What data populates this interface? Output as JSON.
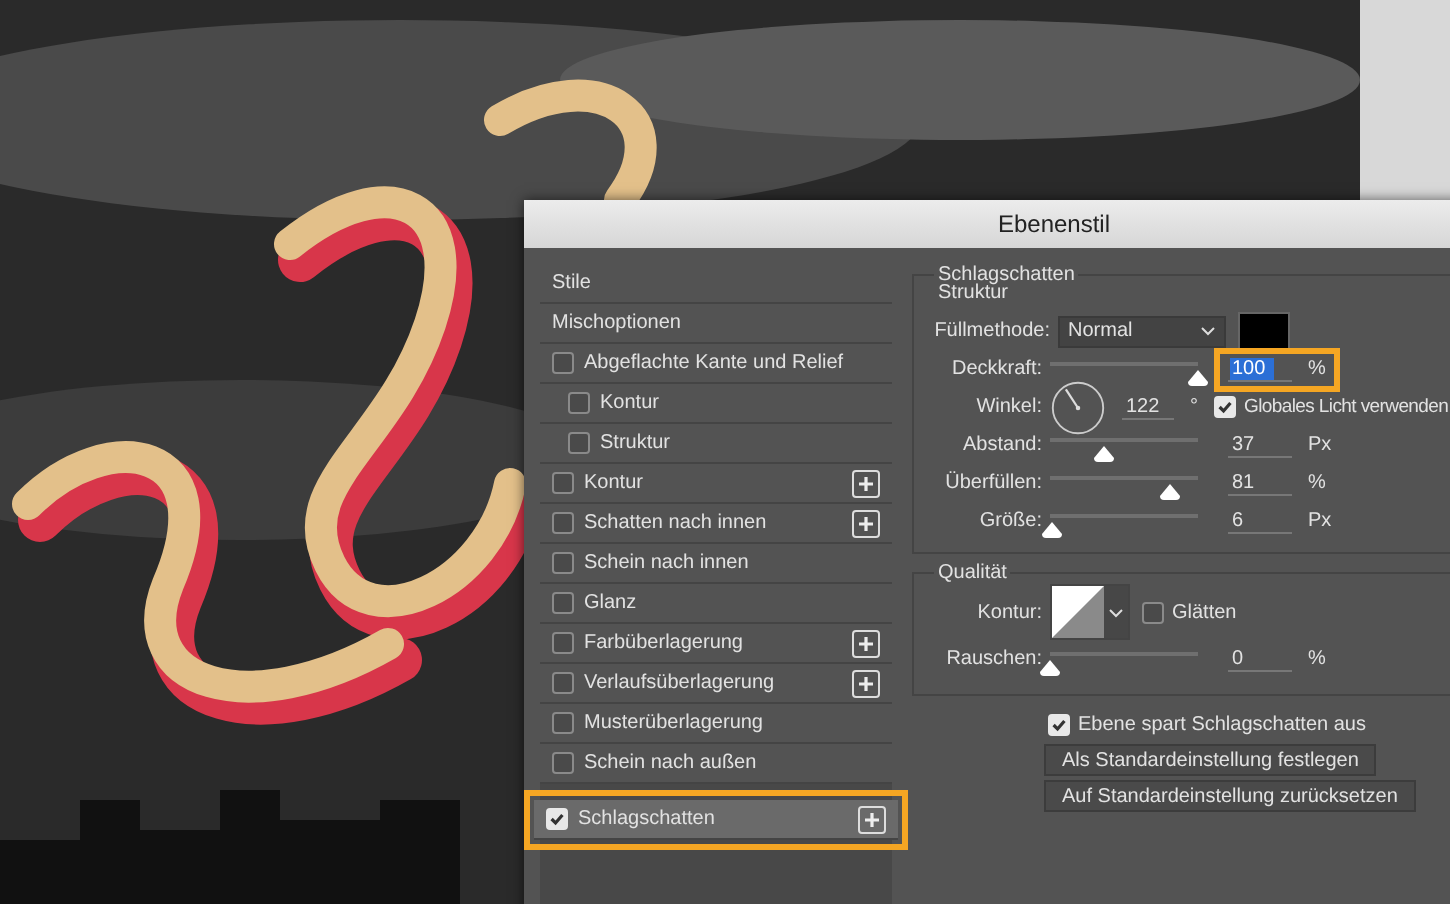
{
  "dialog": {
    "title": "Ebenenstil",
    "styles": [
      {
        "label": "Stile",
        "kind": "header",
        "selected": false,
        "highlighted": false
      },
      {
        "label": "Mischoptionen",
        "kind": "header",
        "selected": false,
        "highlighted": false
      },
      {
        "label": "Abgeflachte Kante und Relief",
        "kind": "check",
        "checked": false,
        "selected": false,
        "highlighted": false,
        "add_button": false,
        "children": [
          {
            "label": "Kontur",
            "kind": "check",
            "checked": false,
            "selected": false,
            "highlighted": false,
            "add_button": false
          },
          {
            "label": "Struktur",
            "kind": "check",
            "checked": false,
            "selected": false,
            "highlighted": false,
            "add_button": false
          }
        ]
      },
      {
        "label": "Kontur",
        "kind": "check",
        "checked": false,
        "selected": false,
        "highlighted": false,
        "add_button": true
      },
      {
        "label": "Schatten nach innen",
        "kind": "check",
        "checked": false,
        "selected": false,
        "highlighted": false,
        "add_button": true
      },
      {
        "label": "Schein nach innen",
        "kind": "check",
        "checked": false,
        "selected": false,
        "highlighted": false,
        "add_button": false
      },
      {
        "label": "Glanz",
        "kind": "check",
        "checked": false,
        "selected": false,
        "highlighted": false,
        "add_button": false
      },
      {
        "label": "Farbüberlagerung",
        "kind": "check",
        "checked": false,
        "selected": false,
        "highlighted": false,
        "add_button": true
      },
      {
        "label": "Verlaufsüberlagerung",
        "kind": "check",
        "checked": false,
        "selected": false,
        "highlighted": false,
        "add_button": true
      },
      {
        "label": "Musterüberlagerung",
        "kind": "check",
        "checked": false,
        "selected": false,
        "highlighted": false,
        "add_button": false
      },
      {
        "label": "Schein nach außen",
        "kind": "check",
        "checked": false,
        "selected": false,
        "highlighted": false,
        "add_button": false
      },
      {
        "label": "Schlagschatten",
        "kind": "check",
        "checked": true,
        "selected": true,
        "highlighted": true,
        "add_button": true
      }
    ],
    "structure": {
      "group_title": "Schlagschatten",
      "subtitle": "Struktur",
      "blend_mode": {
        "label": "Füllmethode:",
        "value": "Normal"
      },
      "rows": [
        {
          "kind": "slider",
          "label": "Deckkraft:",
          "level": 1.0,
          "value": "100",
          "unit": "%",
          "highlighted": true,
          "value_selected": true
        },
        {
          "kind": "angle",
          "label": "Winkel:",
          "value": "122",
          "unit": "°",
          "checkbox": {
            "label": "Globales Licht verwenden",
            "checked": true
          }
        },
        {
          "kind": "slider",
          "label": "Abstand:",
          "level": 0.37,
          "value": "37",
          "unit": "Px",
          "highlighted": false,
          "value_selected": false
        },
        {
          "kind": "slider",
          "label": "Überfüllen:",
          "level": 0.81,
          "value": "81",
          "unit": "%",
          "highlighted": false,
          "value_selected": false
        },
        {
          "kind": "slider",
          "label": "Größe:",
          "level": 0.02,
          "value": "6",
          "unit": "Px",
          "highlighted": false,
          "value_selected": false
        }
      ]
    },
    "quality": {
      "title": "Qualität",
      "contour_label": "Kontur:",
      "smooth": {
        "label": "Glätten",
        "checked": false
      },
      "noise": {
        "label": "Rauschen:",
        "level": 0.0,
        "value": "0",
        "unit": "%"
      }
    },
    "knockout": {
      "label": "Ebene spart Schlagschatten aus",
      "checked": true
    },
    "buttons": [
      "Als Standardeinstellung festlegen",
      "Auf Standardeinstellung zurücksetzen"
    ]
  }
}
